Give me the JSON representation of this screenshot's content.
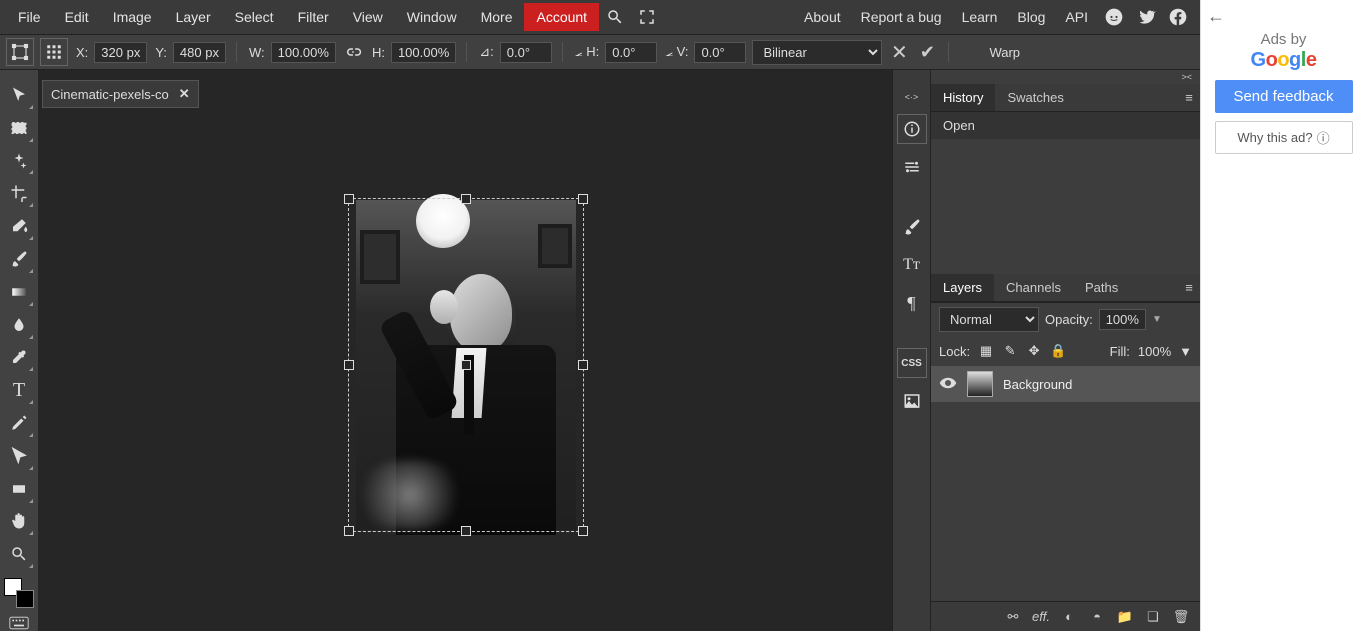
{
  "menu": {
    "file": "File",
    "edit": "Edit",
    "image": "Image",
    "layer": "Layer",
    "select": "Select",
    "filter": "Filter",
    "view": "View",
    "window": "Window",
    "more": "More",
    "account": "Account"
  },
  "rightlinks": {
    "about": "About",
    "bug": "Report a bug",
    "learn": "Learn",
    "blog": "Blog",
    "api": "API"
  },
  "options": {
    "x_label": "X:",
    "x_value": "320 px",
    "y_label": "Y:",
    "y_value": "480 px",
    "w_label": "W:",
    "w_value": "100.00%",
    "h_label": "H:",
    "h_value": "100.00%",
    "ang_label": "⊿:",
    "ang_value": "0.0°",
    "skh_label": "⦟ H:",
    "skh_value": "0.0°",
    "skv_label": "⦟ V:",
    "skv_value": "0.0°",
    "interp": "Bilinear",
    "warp": "Warp"
  },
  "doc": {
    "tab_title": "Cinematic-pexels-co"
  },
  "panels": {
    "history_tab": "History",
    "swatches_tab": "Swatches",
    "history_entry": "Open",
    "layers_tab": "Layers",
    "channels_tab": "Channels",
    "paths_tab": "Paths",
    "blend": "Normal",
    "opacity_label": "Opacity:",
    "opacity_value": "100%",
    "lock_label": "Lock:",
    "fill_label": "Fill:",
    "fill_value": "100%",
    "layer_name": "Background",
    "bottom_eff": "eff."
  },
  "ads": {
    "adsby": "Ads by",
    "google": "Google",
    "send": "Send feedback",
    "why": "Why this ad?"
  }
}
